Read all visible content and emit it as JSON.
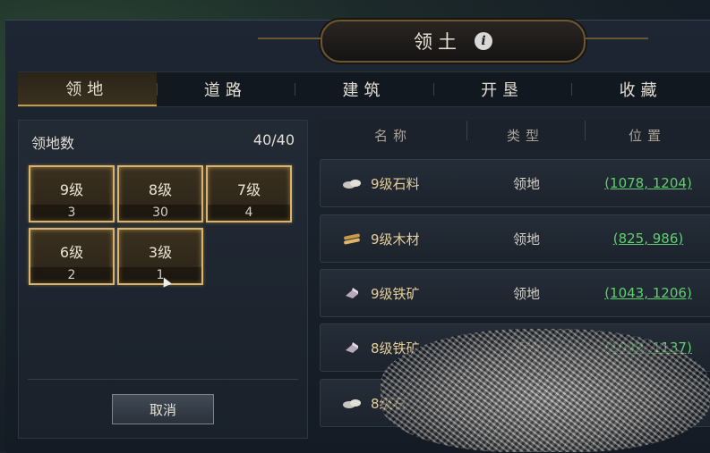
{
  "header": {
    "title": "领土",
    "info_glyph": "i"
  },
  "tabs": [
    {
      "label": "领地",
      "active": true
    },
    {
      "label": "道路",
      "active": false
    },
    {
      "label": "建筑",
      "active": false
    },
    {
      "label": "开垦",
      "active": false
    },
    {
      "label": "收藏",
      "active": false
    }
  ],
  "left_panel": {
    "count_label": "领地数",
    "count_value": "40/40",
    "levels": [
      {
        "level": "9级",
        "count": "3"
      },
      {
        "level": "8级",
        "count": "30"
      },
      {
        "level": "7级",
        "count": "4"
      },
      {
        "level": "6级",
        "count": "2"
      },
      {
        "level": "3级",
        "count": "1"
      }
    ],
    "cancel_label": "取消"
  },
  "table": {
    "headers": [
      "名称",
      "类型",
      "位置"
    ],
    "rows": [
      {
        "icon": "stone-icon",
        "name": "9级石料",
        "type": "领地",
        "position": "(1078, 1204)"
      },
      {
        "icon": "wood-icon",
        "name": "9级木材",
        "type": "领地",
        "position": "(825, 986)"
      },
      {
        "icon": "iron-ore-icon",
        "name": "9级铁矿",
        "type": "领地",
        "position": "(1043, 1206)"
      },
      {
        "icon": "iron-ore-icon",
        "name": "8级铁矿",
        "type": "领地",
        "position": "(1049, 1137)"
      },
      {
        "icon": "stone-icon",
        "name": "8级石",
        "type": "",
        "position": ""
      }
    ]
  },
  "colors": {
    "accent_gold": "#d9b46a",
    "coordinate_green": "#5fcf6f",
    "resource_name": "#e6cf9a"
  }
}
